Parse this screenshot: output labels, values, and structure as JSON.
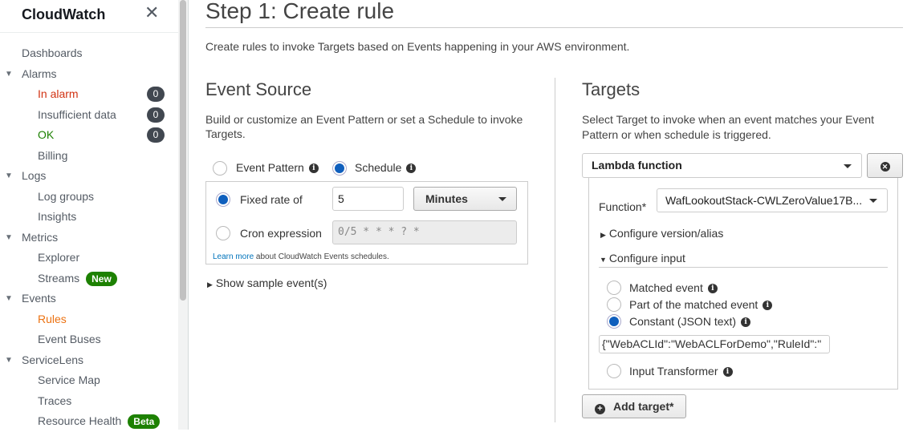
{
  "sidebar": {
    "title": "CloudWatch",
    "items": [
      {
        "label": "Dashboards",
        "level": 0
      },
      {
        "label": "Alarms",
        "level": 0,
        "expanded": true
      },
      {
        "label": "In alarm",
        "level": 1,
        "badge": "0",
        "color": "#d13212"
      },
      {
        "label": "Insufficient data",
        "level": 1,
        "badge": "0"
      },
      {
        "label": "OK",
        "level": 1,
        "badge": "0",
        "color": "#1d8102"
      },
      {
        "label": "Billing",
        "level": 1
      },
      {
        "label": "Logs",
        "level": 0,
        "expanded": true
      },
      {
        "label": "Log groups",
        "level": 1
      },
      {
        "label": "Insights",
        "level": 1
      },
      {
        "label": "Metrics",
        "level": 0,
        "expanded": true
      },
      {
        "label": "Explorer",
        "level": 1
      },
      {
        "label": "Streams",
        "level": 1,
        "pill": "New"
      },
      {
        "label": "Events",
        "level": 0,
        "expanded": true
      },
      {
        "label": "Rules",
        "level": 1,
        "active": true,
        "color": "#ec7211"
      },
      {
        "label": "Event Buses",
        "level": 1
      },
      {
        "label": "ServiceLens",
        "level": 0,
        "expanded": true
      },
      {
        "label": "Service Map",
        "level": 1
      },
      {
        "label": "Traces",
        "level": 1
      },
      {
        "label": "Resource Health",
        "level": 1,
        "pill": "Beta"
      }
    ]
  },
  "page": {
    "title": "Step 1: Create rule",
    "subtitle": "Create rules to invoke Targets based on Events happening in your AWS environment."
  },
  "event_source": {
    "heading": "Event Source",
    "description": "Build or customize an Event Pattern or set a Schedule to invoke Targets.",
    "option_pattern": "Event Pattern",
    "option_schedule": "Schedule",
    "fixed_rate_label": "Fixed rate of",
    "fixed_rate_value": "5",
    "unit": "Minutes",
    "cron_label": "Cron expression",
    "cron_placeholder": "0/5 * * * ? *",
    "learn_more": "Learn more",
    "learn_more_suffix": " about CloudWatch Events schedules.",
    "show_sample": "Show sample event(s)"
  },
  "targets": {
    "heading": "Targets",
    "description": "Select Target to invoke when an event matches your Event Pattern or when schedule is triggered.",
    "target_type": "Lambda function",
    "function_label": "Function*",
    "function_value": "WafLookoutStack-CWLZeroValue17B...",
    "configure_version": "Configure version/alias",
    "configure_input": "Configure input",
    "input_options": [
      "Matched event",
      "Part of the matched event",
      "Constant (JSON text)",
      "Input Transformer"
    ],
    "selected_input": "Constant (JSON text)",
    "json_value": "{\"WebACLId\":\"WebACLForDemo\",\"RuleId\":\"",
    "add_target": "Add target*"
  },
  "colors": {
    "accent": "#0f5fbd",
    "alarm": "#d13212",
    "ok": "#1d8102",
    "active": "#ec7211"
  }
}
